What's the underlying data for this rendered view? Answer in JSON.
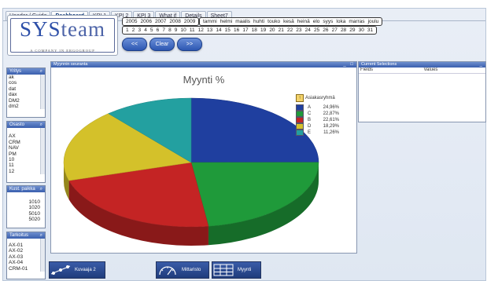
{
  "tabs": [
    {
      "label": "Header / Guide",
      "active": false
    },
    {
      "label": "Dashboard",
      "active": true
    },
    {
      "label": "KPI 1",
      "active": false
    },
    {
      "label": "KPI 2",
      "active": false
    },
    {
      "label": "KPI 3",
      "active": false
    },
    {
      "label": "What if",
      "active": false
    },
    {
      "label": "Details",
      "active": false
    },
    {
      "label": "Sheet7",
      "active": false
    }
  ],
  "logo": {
    "part1": "SYS",
    "part2": "team",
    "sub": "A COMPANY IN ERGOGROUP"
  },
  "years": [
    "2005",
    "2006",
    "2007",
    "2008",
    "2009"
  ],
  "months": [
    "tammi",
    "helmi",
    "maalis",
    "huhti",
    "touko",
    "kesä",
    "heinä",
    "elo",
    "syys",
    "loka",
    "marras",
    "joulu"
  ],
  "days": [
    "1",
    "2",
    "3",
    "4",
    "5",
    "6",
    "7",
    "8",
    "9",
    "10",
    "11",
    "12",
    "13",
    "14",
    "15",
    "16",
    "17",
    "18",
    "19",
    "20",
    "21",
    "22",
    "23",
    "24",
    "25",
    "26",
    "27",
    "28",
    "29",
    "30",
    "31"
  ],
  "buttons": {
    "back": "<<",
    "clear": "Clear",
    "forward": ">>"
  },
  "listboxes": [
    {
      "title": "Yritys",
      "items": [
        "ak",
        "cos",
        "dat",
        "dax",
        "DM2",
        "dm2"
      ],
      "align": "left"
    },
    {
      "title": "Osasto",
      "items": [
        "",
        "AX",
        "CRM",
        "NAV",
        "PM",
        "10",
        "11",
        "12"
      ],
      "align": "left"
    },
    {
      "title": "Kust. paikka",
      "items": [
        "1010",
        "1020",
        "5010",
        "5020"
      ],
      "align": "right"
    },
    {
      "title": "Tarkoitus",
      "items": [
        "",
        "AX-01",
        "AX-02",
        "AX-03",
        "AX-04",
        "CRM-01"
      ],
      "align": "left"
    }
  ],
  "chart_panel": {
    "title": "Myynnin seuranta",
    "window_buttons": "_ □"
  },
  "chart_data": {
    "type": "pie",
    "title": "Myynti %",
    "legend_title": "Asiakasryhmä",
    "legend_position": "right",
    "slices": [
      {
        "label": "A",
        "value": 24.96,
        "value_text": "24,96%",
        "color": "#1f3f9f"
      },
      {
        "label": "C",
        "value": 22.87,
        "value_text": "22,87%",
        "color": "#1f9a3a"
      },
      {
        "label": "B",
        "value": 22.61,
        "value_text": "22,61%",
        "color": "#c42424"
      },
      {
        "label": "D",
        "value": 18.29,
        "value_text": "18,29%",
        "color": "#d4c12a"
      },
      {
        "label": "E",
        "value": 11.26,
        "value_text": "11,26%",
        "color": "#23a0a0"
      }
    ]
  },
  "selections": {
    "title": "Current Selections",
    "col_fields": "Fields",
    "col_values": "Values",
    "window_buttons": "_"
  },
  "bottom_buttons": [
    {
      "label": "Kuvaaja 2"
    },
    {
      "label": "Mittaristo"
    },
    {
      "label": "Myynti"
    }
  ]
}
